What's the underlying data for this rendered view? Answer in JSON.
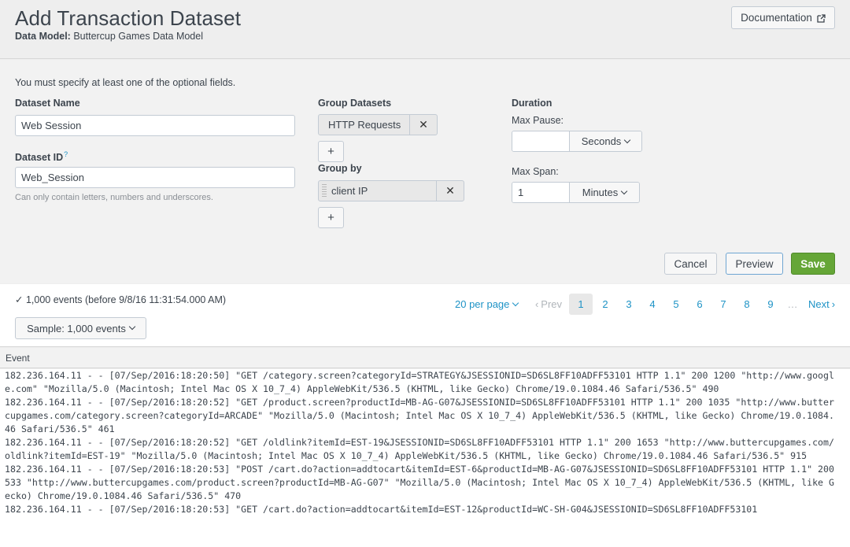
{
  "header": {
    "title": "Add Transaction Dataset",
    "subtitle_label": "Data Model:",
    "subtitle_value": "Buttercup Games Data Model",
    "documentation_label": "Documentation"
  },
  "form": {
    "notice": "You must specify at least one of the optional fields.",
    "dataset_name": {
      "label": "Dataset Name",
      "value": "Web Session"
    },
    "dataset_id": {
      "label": "Dataset ID",
      "help_mark": "?",
      "value": "Web_Session",
      "help": "Can only contain letters, numbers and underscores."
    },
    "group_datasets": {
      "label": "Group Datasets",
      "items": [
        "HTTP Requests"
      ],
      "remove": "✕",
      "add": "+"
    },
    "group_by": {
      "label": "Group by",
      "items": [
        "client IP"
      ],
      "remove": "✕",
      "add": "+"
    },
    "duration": {
      "label": "Duration",
      "max_pause": {
        "label": "Max Pause:",
        "value": "",
        "unit": "Seconds"
      },
      "max_span": {
        "label": "Max Span:",
        "value": "1",
        "unit": "Minutes"
      }
    },
    "buttons": {
      "cancel": "Cancel",
      "preview": "Preview",
      "save": "Save"
    }
  },
  "results": {
    "check": "✓",
    "events_summary": "1,000 events (before 9/8/16 11:31:54.000 AM)",
    "sample_label": "Sample: 1,000 events",
    "per_page": "20 per page",
    "prev": "Prev",
    "next": "Next",
    "pages": [
      "1",
      "2",
      "3",
      "4",
      "5",
      "6",
      "7",
      "8",
      "9"
    ],
    "current_page": "1",
    "ellipsis": "…"
  },
  "table": {
    "column": "Event",
    "events": [
      "182.236.164.11 - - [07/Sep/2016:18:20:50] \"GET /category.screen?categoryId=STRATEGY&JSESSIONID=SD6SL8FF10ADFF53101 HTTP 1.1\" 200 1200 \"http://www.google.com\" \"Mozilla/5.0 (Macintosh; Intel Mac OS X 10_7_4) AppleWebKit/536.5 (KHTML, like Gecko) Chrome/19.0.1084.46 Safari/536.5\" 490",
      "182.236.164.11 - - [07/Sep/2016:18:20:52] \"GET /product.screen?productId=MB-AG-G07&JSESSIONID=SD6SL8FF10ADFF53101 HTTP 1.1\" 200 1035 \"http://www.buttercupgames.com/category.screen?categoryId=ARCADE\" \"Mozilla/5.0 (Macintosh; Intel Mac OS X 10_7_4) AppleWebKit/536.5 (KHTML, like Gecko) Chrome/19.0.1084.46 Safari/536.5\" 461",
      "182.236.164.11 - - [07/Sep/2016:18:20:52] \"GET /oldlink?itemId=EST-19&JSESSIONID=SD6SL8FF10ADFF53101 HTTP 1.1\" 200 1653 \"http://www.buttercupgames.com/oldlink?itemId=EST-19\" \"Mozilla/5.0 (Macintosh; Intel Mac OS X 10_7_4) AppleWebKit/536.5 (KHTML, like Gecko) Chrome/19.0.1084.46 Safari/536.5\" 915",
      "182.236.164.11 - - [07/Sep/2016:18:20:53] \"POST /cart.do?action=addtocart&itemId=EST-6&productId=MB-AG-G07&JSESSIONID=SD6SL8FF10ADFF53101 HTTP 1.1\" 200 533 \"http://www.buttercupgames.com/product.screen?productId=MB-AG-G07\" \"Mozilla/5.0 (Macintosh; Intel Mac OS X 10_7_4) AppleWebKit/536.5 (KHTML, like Gecko) Chrome/19.0.1084.46 Safari/536.5\" 470",
      "182.236.164.11 - - [07/Sep/2016:18:20:53] \"GET /cart.do?action=addtocart&itemId=EST-12&productId=WC-SH-G04&JSESSIONID=SD6SL8FF10ADFF53101"
    ]
  },
  "colors": {
    "link": "#1e93c6",
    "save": "#65a637",
    "text": "#3c444d"
  }
}
